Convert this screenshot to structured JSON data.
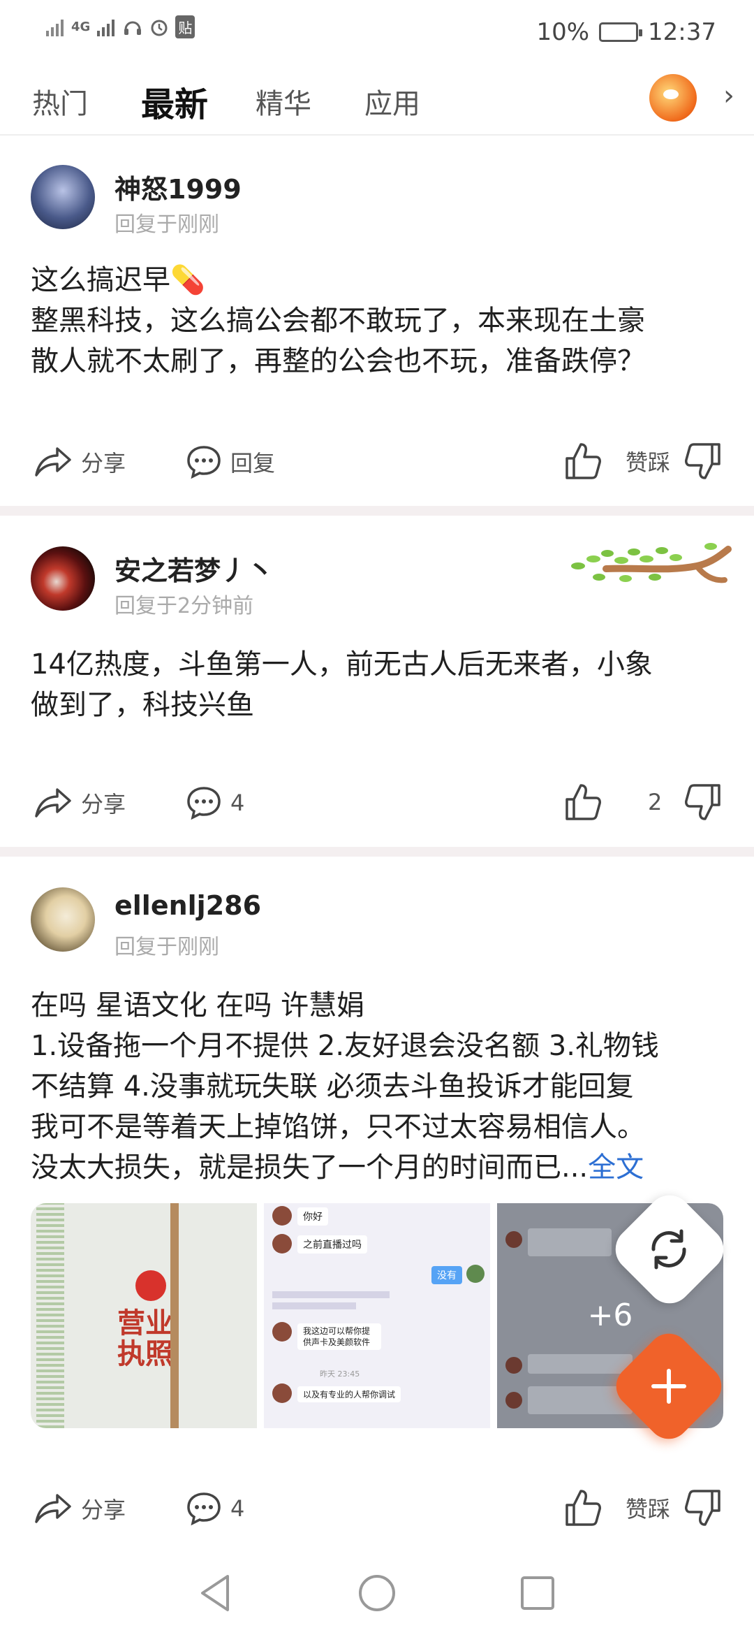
{
  "status_bar": {
    "network": "4G",
    "sim_badge": "贴",
    "battery": "10%",
    "time": "12:37"
  },
  "tabs": [
    {
      "label": "热门",
      "active": false
    },
    {
      "label": "最新",
      "active": true
    },
    {
      "label": "精华",
      "active": false
    },
    {
      "label": "应用",
      "active": false
    }
  ],
  "posts": [
    {
      "username": "神怒1999",
      "time": "回复于刚刚",
      "lines": [
        "这么搞迟早💊",
        "整黑科技，这么搞公会都不敢玩了，本来现在土豪",
        "散人就不太刷了，再整的公会也不玩，准备跌停？"
      ],
      "share_label": "分享",
      "reply_label": "回复",
      "like_label": "赞踩"
    },
    {
      "username": "安之若梦丿丶",
      "time": "回复于2分钟前",
      "lines": [
        "14亿热度，斗鱼第一人，前无古人后无来者，小象",
        "做到了，科技兴鱼"
      ],
      "share_label": "分享",
      "reply_label": "4",
      "like_label": "2"
    },
    {
      "username": "ellenlj286",
      "time": "回复于刚刚",
      "lines": [
        "在吗 星语文化 在吗 许慧娟",
        "1.设备拖一个月不提供 2.友好退会没名额 3.礼物钱",
        "不结算 4.没事就玩失联 必须去斗鱼投诉才能回复",
        "我可不是等着天上掉馅饼，只不过太容易相信人。",
        "没太大损失，就是损失了一个月的时间而已..."
      ],
      "full_text_link": "全文",
      "images": {
        "image1_text": "营业执照",
        "chat1": [
          "你好",
          "之前直播过吗",
          "没有",
          "我这边可以帮你提供声卡及美颜软件",
          "以及有专业的人帮你调试"
        ],
        "chat1_time": "昨天 23:45",
        "more_count": "+6"
      },
      "share_label": "分享",
      "reply_label": "4",
      "like_label": "赞踩"
    }
  ],
  "colors": {
    "accent": "#f0622a",
    "link": "#2d6fd3",
    "separator": "#f4eff0"
  }
}
